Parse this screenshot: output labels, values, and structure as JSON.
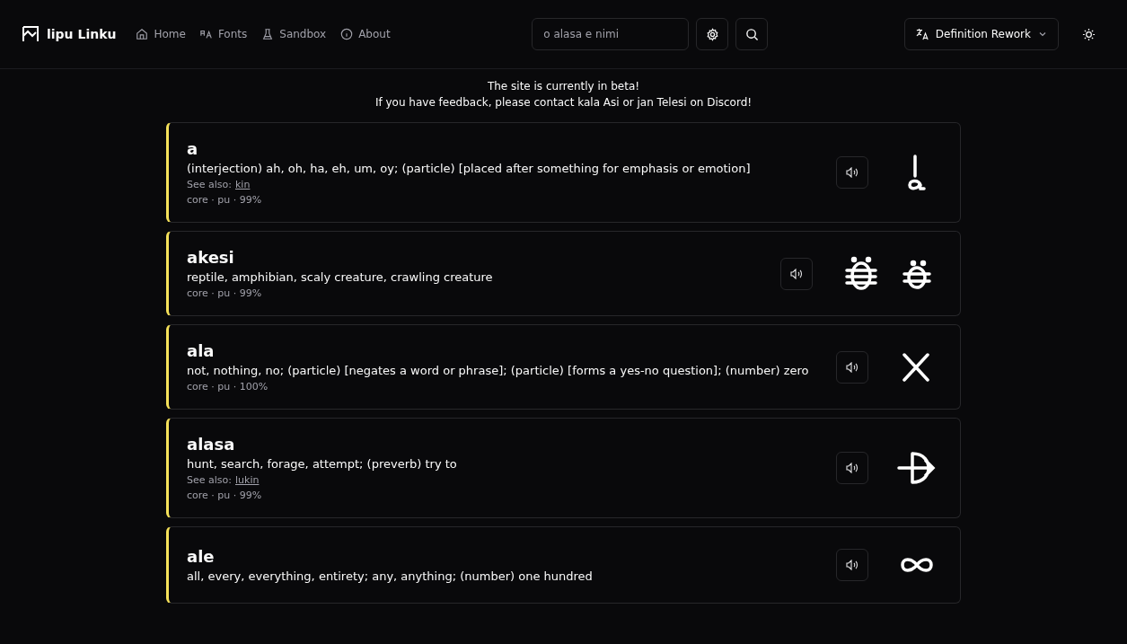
{
  "header": {
    "brand": "lipu Linku",
    "nav": [
      {
        "kind": "home",
        "label": "Home"
      },
      {
        "kind": "fonts",
        "label": "Fonts"
      },
      {
        "kind": "sandbox",
        "label": "Sandbox"
      },
      {
        "kind": "about",
        "label": "About"
      }
    ],
    "search": {
      "placeholder": "o alasa e nimi"
    },
    "language": "Definition Rework"
  },
  "notice": [
    "The site is currently in beta!",
    "If you have feedback, please contact kala Asi or jan Telesi on Discord!"
  ],
  "entries": [
    {
      "word": "a",
      "definition": "(interjection) ah, oh, ha, eh, um, oy; (particle) [placed after something for emphasis or emotion]",
      "see_also_label": "See also:",
      "see_also": "kin",
      "meta": "core · pu · 99%",
      "glyphs": [
        {
          "kind": "a"
        }
      ]
    },
    {
      "word": "akesi",
      "definition": "reptile, amphibian, scaly creature, crawling creature",
      "meta": "core · pu · 99%",
      "glyphs": [
        {
          "kind": "akesi"
        },
        {
          "kind": "akesi-alt"
        }
      ]
    },
    {
      "word": "ala",
      "definition": "not, nothing, no; (particle) [negates a word or phrase]; (particle) [forms a yes-no question]; (number) zero",
      "meta": "core · pu · 100%",
      "glyphs": [
        {
          "kind": "ala"
        }
      ]
    },
    {
      "word": "alasa",
      "definition": "hunt, search, forage, attempt; (preverb) try to",
      "see_also_label": "See also:",
      "see_also": "lukin",
      "meta": "core · pu · 99%",
      "glyphs": [
        {
          "kind": "alasa"
        }
      ]
    },
    {
      "word": "ale",
      "definition": "all, every, everything, entirety; any, anything; (number) one hundred",
      "glyphs": [
        {
          "kind": "ale"
        }
      ]
    }
  ]
}
